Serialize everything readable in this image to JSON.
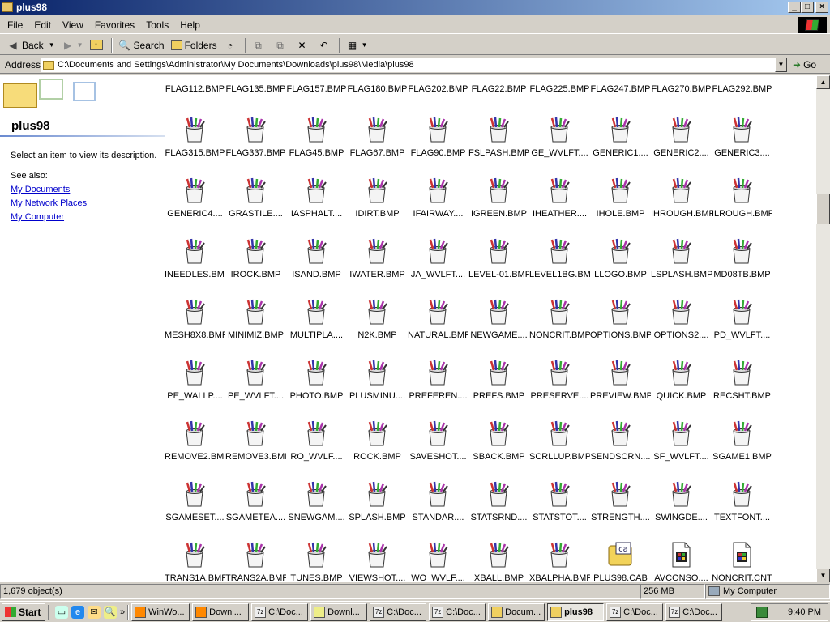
{
  "window": {
    "title": "plus98",
    "min_label": "_",
    "max_label": "□",
    "close_label": "×"
  },
  "menu": [
    "File",
    "Edit",
    "View",
    "Favorites",
    "Tools",
    "Help"
  ],
  "toolbar": {
    "back": "Back",
    "search": "Search",
    "folders": "Folders"
  },
  "address": {
    "label": "Address",
    "value": "C:\\Documents and Settings\\Administrator\\My Documents\\Downloads\\plus98\\Media\\plus98",
    "go": "Go"
  },
  "left_pane": {
    "title": "plus98",
    "description": "Select an item to view its description.",
    "see_also": "See also:",
    "links": [
      "My Documents",
      "My Network Places",
      "My Computer"
    ]
  },
  "files": [
    [
      "FLAG112.BMP",
      "FLAG135.BMP",
      "FLAG157.BMP",
      "FLAG180.BMP",
      "FLAG202.BMP",
      "FLAG22.BMP",
      "FLAG225.BMP",
      "FLAG247.BMP",
      "FLAG270.BMP",
      "FLAG292.BMP"
    ],
    [
      "FLAG315.BMP",
      "FLAG337.BMP",
      "FLAG45.BMP",
      "FLAG67.BMP",
      "FLAG90.BMP",
      "FSLPASH.BMP",
      "GE_WVLFT....",
      "GENERIC1....",
      "GENERIC2....",
      "GENERIC3...."
    ],
    [
      "GENERIC4....",
      "GRASTILE....",
      "IASPHALT....",
      "IDIRT.BMP",
      "IFAIRWAY....",
      "IGREEN.BMP",
      "IHEATHER....",
      "IHOLE.BMP",
      "IHROUGH.BMP",
      "ILROUGH.BMP"
    ],
    [
      "INEEDLES.BMP",
      "IROCK.BMP",
      "ISAND.BMP",
      "IWATER.BMP",
      "JA_WVLFT....",
      "LEVEL-01.BMP",
      "LEVEL1BG.BMP",
      "LLOGO.BMP",
      "LSPLASH.BMP",
      "MD08TB.BMP"
    ],
    [
      "MESH8X8.BMP",
      "MINIMIZ.BMP",
      "MULTIPLA....",
      "N2K.BMP",
      "NATURAL.BMP",
      "NEWGAME....",
      "NONCRIT.BMP",
      "OPTIONS.BMP",
      "OPTIONS2....",
      "PD_WVLFT...."
    ],
    [
      "PE_WALLP....",
      "PE_WVLFT....",
      "PHOTO.BMP",
      "PLUSMINU....",
      "PREFEREN....",
      "PREFS.BMP",
      "PRESERVE....",
      "PREVIEW.BMP",
      "QUICK.BMP",
      "RECSHT.BMP"
    ],
    [
      "REMOVE2.BMP",
      "REMOVE3.BMP",
      "RO_WVLF....",
      "ROCK.BMP",
      "SAVESHOT....",
      "SBACK.BMP",
      "SCRLLUP.BMP",
      "SENDSCRN....",
      "SF_WVLFT....",
      "SGAME1.BMP"
    ],
    [
      "SGAMESET....",
      "SGAMETEA....",
      "SNEWGAM....",
      "SPLASH.BMP",
      "STANDAR....",
      "STATSRND....",
      "STATSTOT....",
      "STRENGTH....",
      "SWINGDE....",
      "TEXTFONT...."
    ],
    [
      "TRANS1A.BMP",
      "TRANS2A.BMP",
      "TUNES.BMP",
      "VIEWSHOT....",
      "WO_WVLF....",
      "XBALL.BMP",
      "XBALPHA.BMP",
      "PLUS98.CAB",
      "AVCONSO....",
      "NONCRIT.CNT"
    ]
  ],
  "status": {
    "objects": "1,679 object(s)",
    "size": "256 MB",
    "location": "My Computer"
  },
  "taskbar": {
    "start": "Start",
    "tasks": [
      "WinWo...",
      "Downl...",
      "C:\\Doc...",
      "Downl...",
      "C:\\Doc...",
      "C:\\Doc...",
      "Docum...",
      "plus98",
      "C:\\Doc...",
      "C:\\Doc..."
    ],
    "clock": "9:40 PM"
  }
}
